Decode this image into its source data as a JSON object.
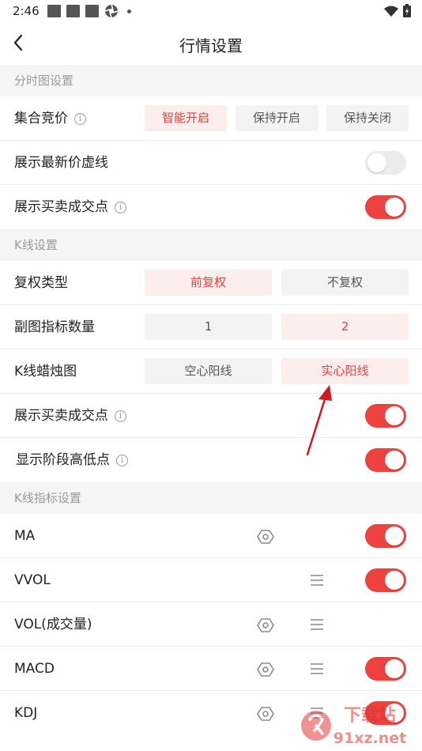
{
  "status_bar": {
    "time": "2:46"
  },
  "header": {
    "title": "行情设置"
  },
  "sections": {
    "timeshare": {
      "title": "分时图设置",
      "auction": {
        "label": "集合竞价",
        "options": [
          "智能开启",
          "保持开启",
          "保持关闭"
        ],
        "selected": 0
      },
      "latest_price_line": {
        "label": "展示最新价虚线",
        "enabled": false
      },
      "trade_points": {
        "label": "展示买卖成交点",
        "enabled": true
      }
    },
    "kline": {
      "title": "K线设置",
      "adjust_type": {
        "label": "复权类型",
        "options": [
          "前复权",
          "不复权"
        ],
        "selected": 0
      },
      "sub_chart_count": {
        "label": "副图指标数量",
        "options": [
          "1",
          "2"
        ],
        "selected": 1
      },
      "candle_style": {
        "label": "K线蜡烛图",
        "options": [
          "空心阳线",
          "实心阳线"
        ],
        "selected": 1
      },
      "trade_points": {
        "label": "展示买卖成交点",
        "enabled": true
      },
      "stage_high_low": {
        "label": "显示阶段高低点",
        "enabled": true
      }
    },
    "indicators": {
      "title": "K线指标设置",
      "items": [
        {
          "name": "MA",
          "enabled": true
        },
        {
          "name": "VVOL",
          "enabled": true
        },
        {
          "name": "VOL(成交量)",
          "enabled": false
        },
        {
          "name": "MACD",
          "enabled": true
        },
        {
          "name": "KDJ",
          "enabled": true
        }
      ]
    }
  },
  "watermark": {
    "text": "下载站",
    "url_text": "91xz.net"
  },
  "colors": {
    "accent": "#ee4241",
    "active_text": "#e8413d",
    "active_bg": "#fdeeee",
    "section_bg": "#f5f5f5"
  }
}
